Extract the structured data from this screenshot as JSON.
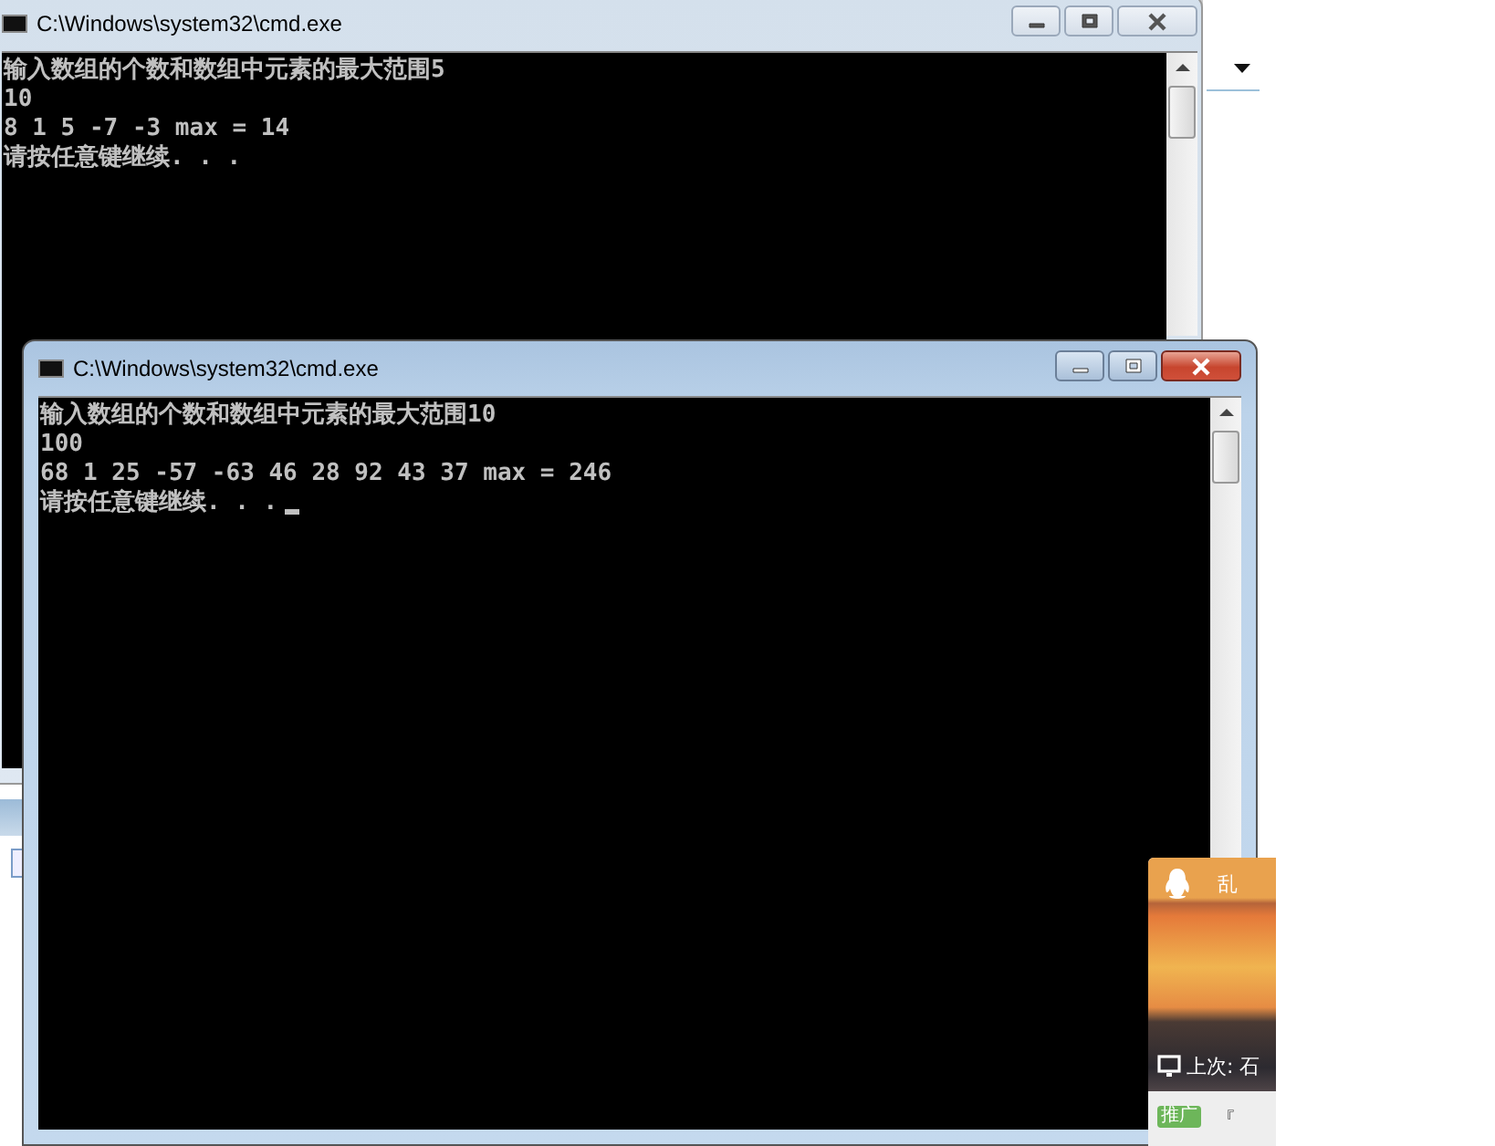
{
  "windows": [
    {
      "title": "C:\\Windows\\system32\\cmd.exe",
      "active": false,
      "cursor": false,
      "lines": [
        "输入数组的个数和数组中元素的最大范围5",
        "10",
        "8 1 5 -7 -3 max = 14",
        "请按任意键继续. . ."
      ]
    },
    {
      "title": "C:\\Windows\\system32\\cmd.exe",
      "active": true,
      "cursor": true,
      "lines": [
        "输入数组的个数和数组中元素的最大范围10",
        "100",
        "68 1 25 -57 -63 46 28 92 43 37 max = 246",
        "请按任意键继续. . ."
      ]
    }
  ],
  "notification": {
    "name": "乱",
    "last_login": "上次: 石",
    "badge": "推广",
    "snippet": "『"
  }
}
